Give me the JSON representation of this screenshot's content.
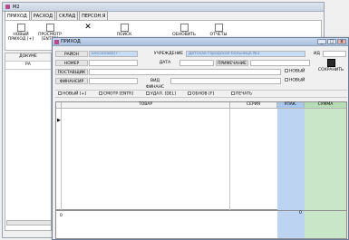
{
  "back_window": {
    "title": "М2",
    "tabs": [
      "ПРИХОД",
      "РАСХОД",
      "СКЛАД",
      "ПЕРСОН.Я"
    ],
    "toolbar": [
      {
        "icon": "document-icon",
        "label": "НОВЫЙ ПРИХОД [+]"
      },
      {
        "icon": "document-icon",
        "label": "ПРОСМОТР [ENTER]"
      },
      {
        "icon": "close-icon",
        "label": ""
      },
      {
        "icon": "search-icon",
        "label": "ПОИСК"
      },
      {
        "icon": "refresh-icon",
        "label": "ОБНОВИТЬ"
      },
      {
        "icon": "print-icon",
        "label": "ОТЧЕТЫ"
      }
    ],
    "grid_header": "ДОКУМЕ",
    "grid_subheader": "РА"
  },
  "dialog": {
    "title": "ПРИХОД",
    "window_buttons": [
      "_",
      "□",
      "x"
    ],
    "fields": {
      "rayon_label": "РАЙОН",
      "rayon_value": "Бессонова(? -",
      "uchrezhdenie_label": "УЧРЕЖДЕНИЕ",
      "uchrezhdenie_value": "Детская городская больница №1",
      "id_label": "ИД",
      "nomer_label": "НОМЕР",
      "nomer_value": "",
      "data_label": "ДАТА",
      "data_value": "",
      "primechanie_label": "ПРИМЕЧАНИЕ",
      "primechanie_value": "",
      "postavshik_label": "ПОСТАВЩИК",
      "postavshik_value": "",
      "finansir_label": "ФИНАНСИР",
      "finansir_value": "",
      "vid_finans_label": "ВИД ФИНАНС",
      "vid_finans_value": "",
      "novyi1": "НОВЫЙ",
      "novyi2": "НОВЫЙ"
    },
    "save_label": "СОХРАНИТЬ",
    "toolbar": [
      {
        "icon": "add-icon",
        "label": "НОВЫЙ [+]"
      },
      {
        "icon": "view-icon",
        "label": "СМОТР [ENTR]"
      },
      {
        "icon": "delete-icon",
        "label": "УДАЛ. [DEL]"
      },
      {
        "icon": "refresh-icon",
        "label": "ОБНОВ [F]"
      },
      {
        "icon": "print-icon",
        "label": "ПЕЧАТЬ"
      }
    ],
    "grid": {
      "columns": [
        "ТОВАР",
        "СЕРИЯ",
        "УПАК.",
        "СУММА"
      ],
      "row_marker": "▶",
      "sum_marker": "0",
      "sum_value": "0"
    }
  }
}
